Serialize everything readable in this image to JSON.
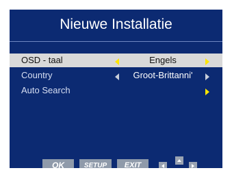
{
  "header": {
    "title": "Nieuwe Installatie"
  },
  "menu": {
    "items": [
      {
        "label": "OSD - taal",
        "value": "Engels",
        "selected": true
      },
      {
        "label": "Country",
        "value": "Groot-Brittanni'",
        "selected": false
      },
      {
        "label": "Auto Search",
        "value": "",
        "selected": false
      }
    ]
  },
  "footer": {
    "ok_label": "OK",
    "setup_label": "SETUP",
    "exit_label": "EXIT"
  },
  "colors": {
    "background": "#0c2a72",
    "selected_row": "#d9d9d9",
    "arrow_active": "#ffe600",
    "arrow_inactive": "#c8ceda",
    "footer_button": "#8f9aaa"
  },
  "icons": {
    "left": "triangle-left-icon",
    "right": "triangle-right-icon",
    "up": "triangle-up-icon",
    "down": "triangle-down-icon"
  }
}
